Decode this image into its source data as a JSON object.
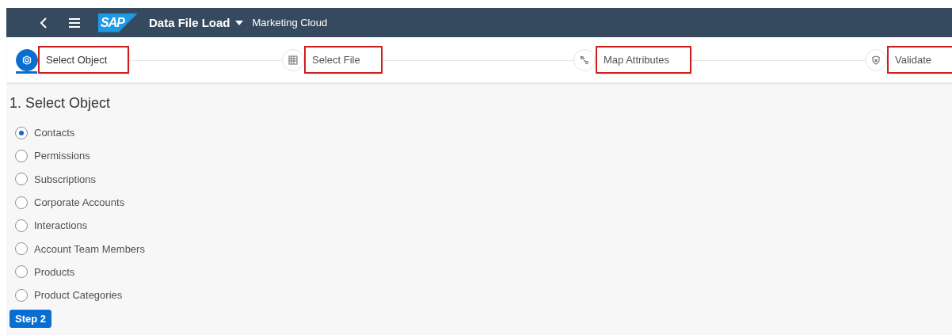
{
  "shell_bar": {
    "logo": "SAP",
    "app_title": "Data File Load",
    "product": "Marketing Cloud"
  },
  "steps": [
    {
      "label": "Select Object",
      "kind": "object",
      "selected": true,
      "highlighted": true
    },
    {
      "label": "Select File",
      "kind": "file",
      "selected": false,
      "highlighted": true
    },
    {
      "label": "Map Attributes",
      "kind": "map",
      "selected": false,
      "highlighted": true
    },
    {
      "label": "Validate",
      "kind": "validate",
      "selected": false,
      "highlighted": true
    }
  ],
  "section_title": "1. Select Object",
  "options": [
    {
      "label": "Contacts",
      "selected": true
    },
    {
      "label": "Permissions",
      "selected": false
    },
    {
      "label": "Subscriptions",
      "selected": false
    },
    {
      "label": "Corporate Accounts",
      "selected": false
    },
    {
      "label": "Interactions",
      "selected": false
    },
    {
      "label": "Account Team Members",
      "selected": false
    },
    {
      "label": "Products",
      "selected": false
    },
    {
      "label": "Product Categories",
      "selected": false
    }
  ],
  "next_button": "Step 2"
}
